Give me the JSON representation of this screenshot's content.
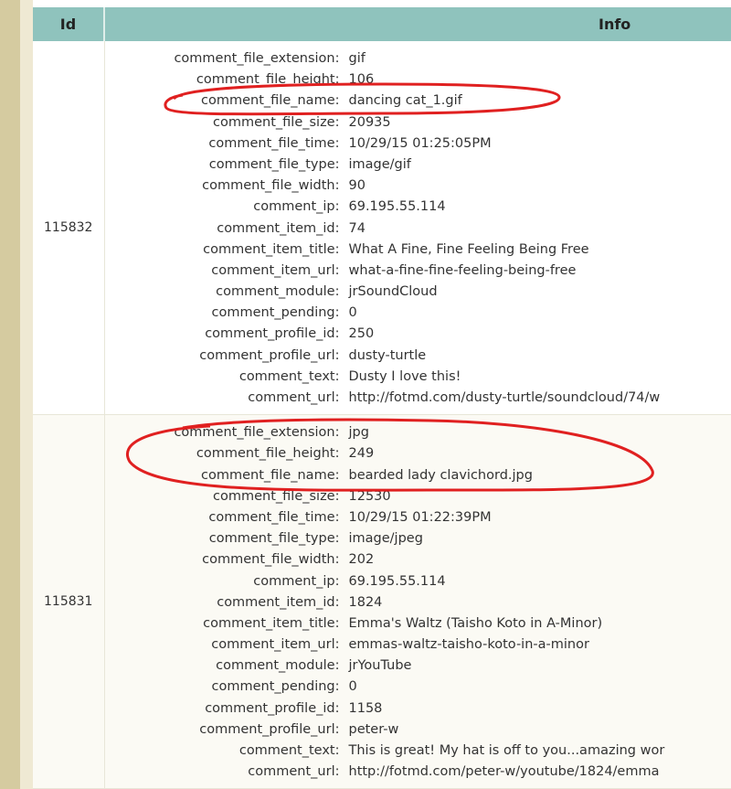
{
  "table": {
    "headers": [
      "Id",
      "Info"
    ],
    "rows": [
      {
        "id": "115832",
        "fields": [
          [
            "comment_file_extension:",
            "gif"
          ],
          [
            "comment_file_height:",
            "106"
          ],
          [
            "comment_file_name:",
            "dancing cat_1.gif"
          ],
          [
            "comment_file_size:",
            "20935"
          ],
          [
            "comment_file_time:",
            "10/29/15 01:25:05PM"
          ],
          [
            "comment_file_type:",
            "image/gif"
          ],
          [
            "comment_file_width:",
            "90"
          ],
          [
            "comment_ip:",
            "69.195.55.114"
          ],
          [
            "comment_item_id:",
            "74"
          ],
          [
            "comment_item_title:",
            "What A Fine, Fine Feeling Being Free"
          ],
          [
            "comment_item_url:",
            "what-a-fine-fine-feeling-being-free"
          ],
          [
            "comment_module:",
            "jrSoundCloud"
          ],
          [
            "comment_pending:",
            "0"
          ],
          [
            "comment_profile_id:",
            "250"
          ],
          [
            "comment_profile_url:",
            "dusty-turtle"
          ],
          [
            "comment_text:",
            "Dusty I love this!"
          ],
          [
            "comment_url:",
            "http://fotmd.com/dusty-turtle/soundcloud/74/w"
          ]
        ]
      },
      {
        "id": "115831",
        "fields": [
          [
            "comment_file_extension:",
            "jpg"
          ],
          [
            "comment_file_height:",
            "249"
          ],
          [
            "comment_file_name:",
            "bearded lady clavichord.jpg"
          ],
          [
            "comment_file_size:",
            "12530"
          ],
          [
            "comment_file_time:",
            "10/29/15 01:22:39PM"
          ],
          [
            "comment_file_type:",
            "image/jpeg"
          ],
          [
            "comment_file_width:",
            "202"
          ],
          [
            "comment_ip:",
            "69.195.55.114"
          ],
          [
            "comment_item_id:",
            "1824"
          ],
          [
            "comment_item_title:",
            "Emma's Waltz (Taisho Koto in A-Minor)"
          ],
          [
            "comment_item_url:",
            "emmas-waltz-taisho-koto-in-a-minor"
          ],
          [
            "comment_module:",
            "jrYouTube"
          ],
          [
            "comment_pending:",
            "0"
          ],
          [
            "comment_profile_id:",
            "1158"
          ],
          [
            "comment_profile_url:",
            "peter-w"
          ],
          [
            "comment_text:",
            "This is great!  My hat is off to you...amazing wor"
          ],
          [
            "comment_url:",
            "http://fotmd.com/peter-w/youtube/1824/emma"
          ]
        ]
      }
    ]
  },
  "colors": {
    "header": "#8fc3bd",
    "annotation": "#e02020"
  }
}
